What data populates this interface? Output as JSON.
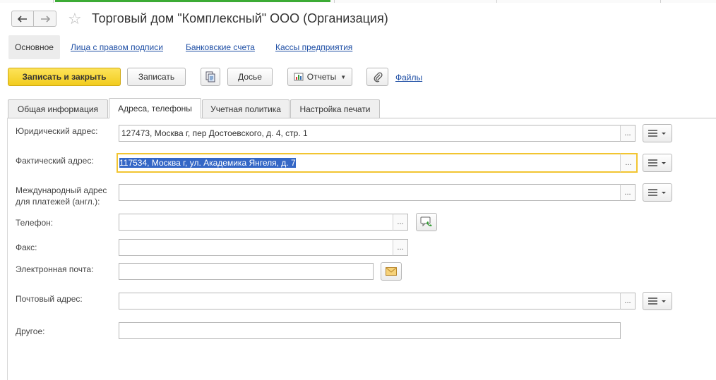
{
  "window": {
    "title": "Торговый дом \"Комплексный\" ООО (Организация)"
  },
  "nav": {
    "back_icon": "arrow-left-icon",
    "forward_icon": "arrow-right-icon",
    "favorite_icon": "star-icon"
  },
  "panel": {
    "active": "Основное",
    "links": [
      "Лица с правом подписи",
      "Банковские счета",
      "Кассы предприятия"
    ]
  },
  "toolbar": {
    "save_close": "Записать и закрыть",
    "save": "Записать",
    "dossier": "Досье",
    "reports": "Отчеты",
    "files": "Файлы",
    "doc_icon": "document-copy-icon",
    "attach_icon": "paperclip-icon",
    "reports_icon": "bar-chart-icon"
  },
  "tabs": [
    {
      "label": "Общая информация",
      "active": false
    },
    {
      "label": "Адреса, телефоны",
      "active": true
    },
    {
      "label": "Учетная политика",
      "active": false
    },
    {
      "label": "Настройка печати",
      "active": false
    }
  ],
  "form": {
    "legal_address": {
      "label": "Юридический адрес:",
      "value": "127473, Москва г, пер Достоевского, д. 4, стр. 1"
    },
    "actual_address": {
      "label": "Фактический адрес:",
      "value": "117534, Москва г, ул. Академика Янгеля, д. 7"
    },
    "intl_address": {
      "label": "Международный адрес для платежей (англ.):",
      "value": ""
    },
    "phone": {
      "label": "Телефон:",
      "value": ""
    },
    "fax": {
      "label": "Факс:",
      "value": ""
    },
    "email": {
      "label": "Электронная почта:",
      "value": ""
    },
    "postal_address": {
      "label": "Почтовый адрес:",
      "value": ""
    },
    "other": {
      "label": "Другое:",
      "value": ""
    },
    "dots": "...",
    "phone_icon": "phone-call-icon",
    "email_icon": "envelope-icon",
    "menu_icon": "hamburger-menu-icon"
  },
  "colors": {
    "accent_yellow": "#f2cc1e",
    "link_blue": "#1f4fa5",
    "selection": "#3467c6",
    "focus_border": "#f2c531",
    "active_green": "#3cab35"
  }
}
